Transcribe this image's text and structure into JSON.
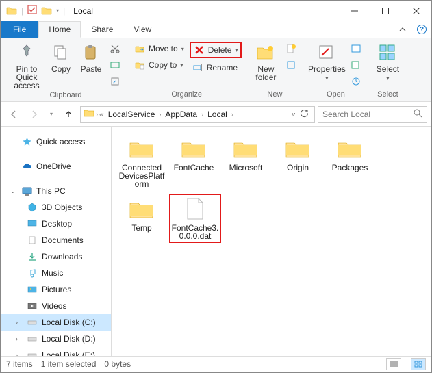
{
  "window": {
    "title": "Local"
  },
  "tabs": {
    "file": "File",
    "home": "Home",
    "share": "Share",
    "view": "View"
  },
  "ribbon": {
    "clipboard": {
      "label": "Clipboard",
      "pin": "Pin to Quick access",
      "copy": "Copy",
      "paste": "Paste"
    },
    "organize": {
      "label": "Organize",
      "moveto": "Move to",
      "copyto": "Copy to",
      "delete": "Delete",
      "rename": "Rename"
    },
    "new": {
      "label": "New",
      "newfolder": "New folder"
    },
    "open": {
      "label": "Open",
      "properties": "Properties"
    },
    "select": {
      "label": "Select",
      "select": "Select"
    }
  },
  "breadcrumbs": [
    "LocalService",
    "AppData",
    "Local"
  ],
  "search_placeholder": "Search Local",
  "sidebar": {
    "quick": "Quick access",
    "onedrive": "OneDrive",
    "thispc": "This PC",
    "items": [
      "3D Objects",
      "Desktop",
      "Documents",
      "Downloads",
      "Music",
      "Pictures",
      "Videos",
      "Local Disk (C:)",
      "Local Disk (D:)",
      "Local Disk (E:)"
    ]
  },
  "files": [
    {
      "name": "Connected DevicesPlatform",
      "type": "folder"
    },
    {
      "name": "FontCache",
      "type": "folder"
    },
    {
      "name": "Microsoft",
      "type": "folder"
    },
    {
      "name": "Origin",
      "type": "folder"
    },
    {
      "name": "Packages",
      "type": "folder"
    },
    {
      "name": "Temp",
      "type": "folder"
    },
    {
      "name": "FontCache3.0.0.0.dat",
      "type": "file",
      "selected": true
    }
  ],
  "status": {
    "count": "7 items",
    "selected": "1 item selected",
    "size": "0 bytes"
  }
}
